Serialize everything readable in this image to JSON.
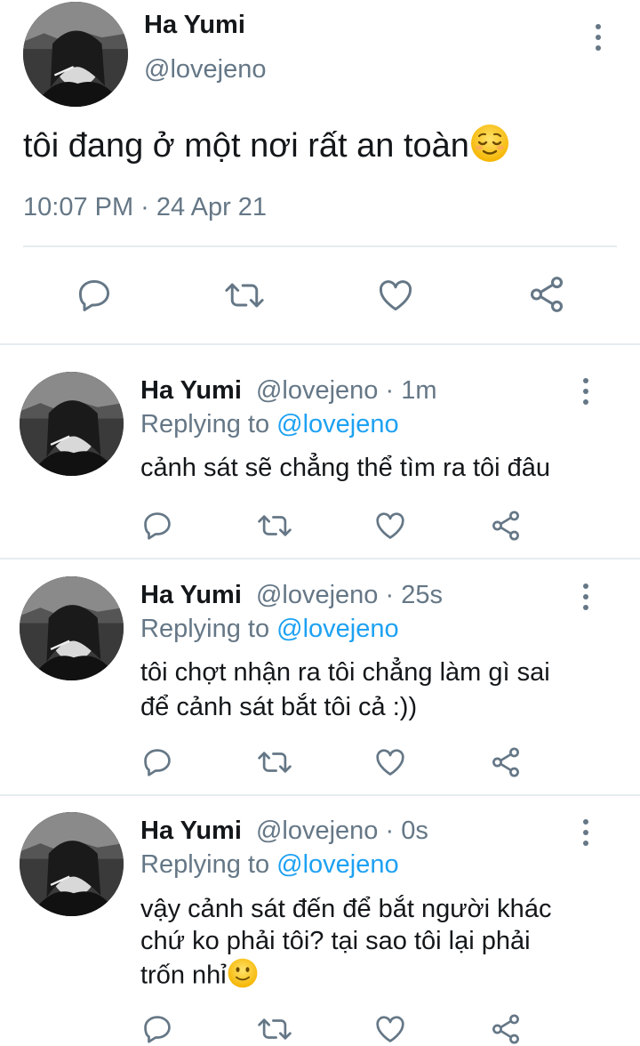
{
  "main_tweet": {
    "display_name": "Ha Yumi",
    "handle": "@lovejeno",
    "text": "tôi đang ở một nơi rất an toàn",
    "emoji": "relieved-face",
    "timestamp": "10:07 PM · 24 Apr 21"
  },
  "replies": [
    {
      "display_name": "Ha Yumi",
      "handle": "@lovejeno",
      "time": "· 1m",
      "replying_prefix": "Replying to",
      "replying_handle": "@lovejeno",
      "lines": [
        "cảnh sát sẽ chẳng thể tìm ra tôi đâu"
      ]
    },
    {
      "display_name": "Ha Yumi",
      "handle": "@lovejeno",
      "time": "· 25s",
      "replying_prefix": "Replying to",
      "replying_handle": "@lovejeno",
      "lines": [
        "tôi chợt nhận ra tôi chẳng làm gì sai",
        "để cảnh sát bắt tôi cả :))"
      ]
    },
    {
      "display_name": "Ha Yumi",
      "handle": "@lovejeno",
      "time": "· 0s",
      "replying_prefix": "Replying to",
      "replying_handle": "@lovejeno",
      "lines": [
        "vậy cảnh sát đến để bắt người khác",
        "chứ ko phải tôi? tại sao tôi lại phải",
        "trốn nhỉ"
      ],
      "emoji": "slightly-smiling-face"
    }
  ],
  "colors": {
    "text": "#14171a",
    "muted": "#657786",
    "link": "#1da1f2",
    "divider": "#e6ecf0"
  }
}
